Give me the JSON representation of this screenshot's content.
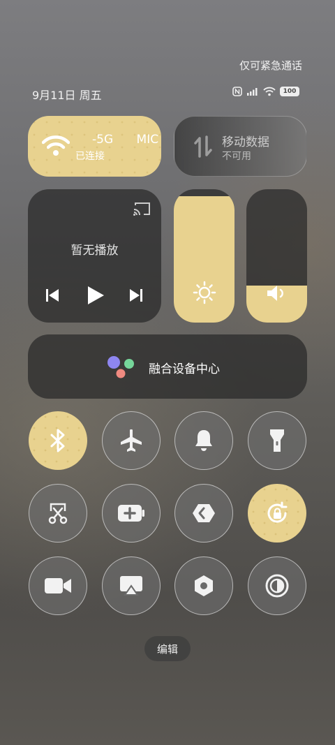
{
  "status_bar": {
    "emergency_only": "仅可紧急通话",
    "date": "9月11日 周五",
    "battery": "100"
  },
  "tiles": {
    "wifi": {
      "ssid": "-5G",
      "ssid_tail": "MIC",
      "status": "已连接"
    },
    "mobile_data": {
      "label": "移动数据",
      "status": "不可用"
    },
    "media": {
      "status": "暂无播放"
    },
    "brightness": {
      "level": 0.95
    },
    "volume": {
      "level": 0.28
    },
    "device_center": {
      "label": "融合设备中心"
    }
  },
  "toggles": [
    {
      "name": "bluetooth",
      "on": true
    },
    {
      "name": "airplane-mode",
      "on": false
    },
    {
      "name": "ring",
      "on": false
    },
    {
      "name": "flashlight",
      "on": false
    },
    {
      "name": "screenshot",
      "on": false
    },
    {
      "name": "battery-saver",
      "on": false
    },
    {
      "name": "nfc",
      "on": false
    },
    {
      "name": "rotation-lock",
      "on": true
    },
    {
      "name": "screen-record",
      "on": false
    },
    {
      "name": "screen-cast",
      "on": false
    },
    {
      "name": "settings-nut",
      "on": false
    },
    {
      "name": "dark-mode",
      "on": false
    }
  ],
  "edit_button": {
    "label": "编辑"
  },
  "colors": {
    "accent": "#e8d28f",
    "tile_dark": "#3a3a3a"
  }
}
